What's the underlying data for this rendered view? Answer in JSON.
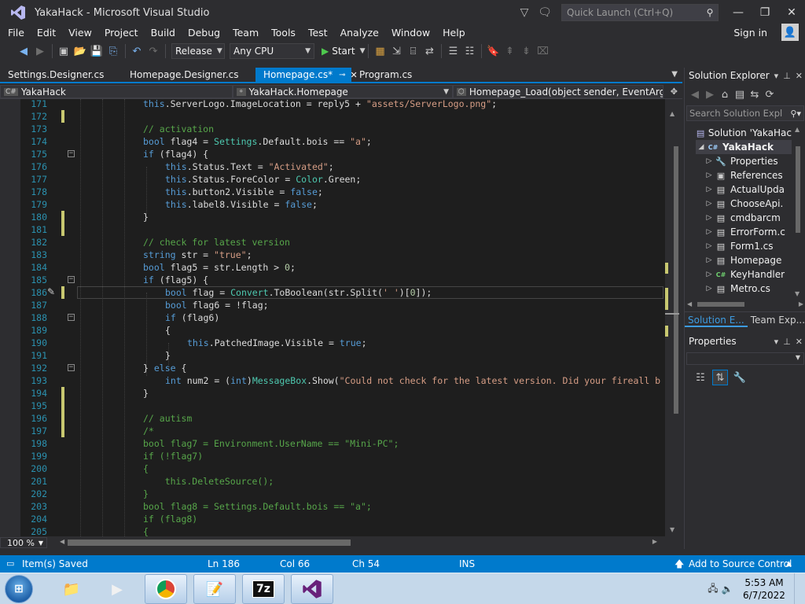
{
  "window": {
    "title": "YakaHack - Microsoft Visual Studio"
  },
  "quick_launch": {
    "placeholder": "Quick Launch (Ctrl+Q)"
  },
  "menu": [
    "File",
    "Edit",
    "View",
    "Project",
    "Build",
    "Debug",
    "Team",
    "Tools",
    "Test",
    "Analyze",
    "Window",
    "Help"
  ],
  "account": {
    "signin": "Sign in"
  },
  "toolbar": {
    "configuration": "Release",
    "platform": "Any CPU",
    "start": "Start"
  },
  "tabs": [
    {
      "label": "Settings.Designer.cs",
      "active": false
    },
    {
      "label": "Homepage.Designer.cs",
      "active": false
    },
    {
      "label": "Homepage.cs*",
      "active": true
    },
    {
      "label": "Program.cs",
      "active": false
    }
  ],
  "navbar": {
    "project": "YakaHack",
    "class": "YakaHack.Homepage",
    "member": "Homepage_Load(object sender, EventArgs e)"
  },
  "code_lines": [
    {
      "n": "171",
      "html": "<span class=\"kw\">this</span>.ServerLogo.ImageLocation = reply5 + <span class=\"str\">\"assets/ServerLogo.png\"</span>;",
      "indent": 4,
      "chg": false,
      "fold": false
    },
    {
      "n": "172",
      "html": "",
      "indent": 4,
      "chg": true,
      "fold": false
    },
    {
      "n": "173",
      "html": "<span class=\"cm\">// activation</span>",
      "indent": 4,
      "chg": false,
      "fold": false
    },
    {
      "n": "174",
      "html": "<span class=\"kw\">bool</span> flag4 = <span class=\"ty\">Settings</span>.Default.bois == <span class=\"str\">\"a\"</span>;",
      "indent": 4,
      "chg": false,
      "fold": false
    },
    {
      "n": "175",
      "html": "<span class=\"kw\">if</span> (flag4) {",
      "indent": 4,
      "chg": false,
      "fold": true
    },
    {
      "n": "176",
      "html": "<span class=\"kw\">this</span>.Status.Text = <span class=\"str\">\"Activated\"</span>;",
      "indent": 8,
      "chg": false,
      "fold": false
    },
    {
      "n": "177",
      "html": "<span class=\"kw\">this</span>.Status.ForeColor = <span class=\"ty\">Color</span>.Green;",
      "indent": 8,
      "chg": false,
      "fold": false
    },
    {
      "n": "178",
      "html": "<span class=\"kw\">this</span>.button2.Visible = <span class=\"kw\">false</span>;",
      "indent": 8,
      "chg": false,
      "fold": false
    },
    {
      "n": "179",
      "html": "<span class=\"kw\">this</span>.label8.Visible = <span class=\"kw\">false</span>;",
      "indent": 8,
      "chg": false,
      "fold": false
    },
    {
      "n": "180",
      "html": "}",
      "indent": 4,
      "chg": true,
      "fold": false
    },
    {
      "n": "181",
      "html": "",
      "indent": 4,
      "chg": true,
      "fold": false
    },
    {
      "n": "182",
      "html": "<span class=\"cm\">// check for latest version</span>",
      "indent": 4,
      "chg": false,
      "fold": false
    },
    {
      "n": "183",
      "html": "<span class=\"kw\">string</span> str = <span class=\"str\">\"true\"</span>;",
      "indent": 4,
      "chg": false,
      "fold": false
    },
    {
      "n": "184",
      "html": "<span class=\"kw\">bool</span> flag5 = str.Length &gt; <span class=\"num\">0</span>;",
      "indent": 4,
      "chg": false,
      "fold": false
    },
    {
      "n": "185",
      "html": "<span class=\"kw\">if</span> (flag5) {",
      "indent": 4,
      "chg": false,
      "fold": true
    },
    {
      "n": "186",
      "html": "<span class=\"kw\">bool</span> flag = <span class=\"ty\">Convert</span>.ToBoolean(str.Split(<span class=\"str\">' '</span>)[<span class=\"num\">0</span>]);",
      "indent": 8,
      "chg": true,
      "fold": false
    },
    {
      "n": "187",
      "html": "<span class=\"kw\">bool</span> flag6 = !flag;",
      "indent": 8,
      "chg": false,
      "fold": false
    },
    {
      "n": "188",
      "html": "<span class=\"kw\">if</span> (flag6)",
      "indent": 8,
      "chg": false,
      "fold": true
    },
    {
      "n": "189",
      "html": "{",
      "indent": 8,
      "chg": false,
      "fold": false
    },
    {
      "n": "190",
      "html": "<span class=\"kw\">this</span>.PatchedImage.Visible = <span class=\"kw\">true</span>;",
      "indent": 12,
      "chg": false,
      "fold": false
    },
    {
      "n": "191",
      "html": "}",
      "indent": 8,
      "chg": false,
      "fold": false
    },
    {
      "n": "192",
      "html": "} <span class=\"kw\">else</span> {",
      "indent": 4,
      "chg": false,
      "fold": true
    },
    {
      "n": "193",
      "html": "<span class=\"kw\">int</span> num2 = (<span class=\"kw\">int</span>)<span class=\"ty\">MessageBox</span>.Show(<span class=\"str\">\"Could not check for the latest version. Did your fireall b</span>",
      "indent": 8,
      "chg": false,
      "fold": false
    },
    {
      "n": "194",
      "html": "}",
      "indent": 4,
      "chg": true,
      "fold": false
    },
    {
      "n": "195",
      "html": "",
      "indent": 4,
      "chg": true,
      "fold": false
    },
    {
      "n": "196",
      "html": "<span class=\"cm\">// autism</span>",
      "indent": 4,
      "chg": true,
      "fold": false
    },
    {
      "n": "197",
      "html": "<span class=\"cm\">/*</span>",
      "indent": 4,
      "chg": true,
      "fold": false
    },
    {
      "n": "198",
      "html": "<span class=\"cm\">bool flag7 = Environment.UserName == \"Mini-PC\";</span>",
      "indent": 4,
      "chg": false,
      "fold": false
    },
    {
      "n": "199",
      "html": "<span class=\"cm\">if (!flag7)</span>",
      "indent": 4,
      "chg": false,
      "fold": false
    },
    {
      "n": "200",
      "html": "<span class=\"cm\">{</span>",
      "indent": 4,
      "chg": false,
      "fold": false
    },
    {
      "n": "201",
      "html": "<span class=\"cm\">    this.DeleteSource();</span>",
      "indent": 4,
      "chg": false,
      "fold": false
    },
    {
      "n": "202",
      "html": "<span class=\"cm\">}</span>",
      "indent": 4,
      "chg": false,
      "fold": false
    },
    {
      "n": "203",
      "html": "<span class=\"cm\">bool flag8 = Settings.Default.bois == \"a\";</span>",
      "indent": 4,
      "chg": false,
      "fold": false
    },
    {
      "n": "204",
      "html": "<span class=\"cm\">if (flag8)</span>",
      "indent": 4,
      "chg": false,
      "fold": false
    },
    {
      "n": "205",
      "html": "<span class=\"cm\">{</span>",
      "indent": 4,
      "chg": false,
      "fold": false
    }
  ],
  "editor": {
    "zoom": "100 %"
  },
  "solution_explorer": {
    "title": "Solution Explorer",
    "search_placeholder": "Search Solution Expl",
    "items": [
      {
        "label": "Solution 'YakaHac",
        "icon": "solution-icon",
        "depth": 0,
        "arrow": "",
        "sel": false
      },
      {
        "label": "YakaHack",
        "icon": "csharp-project-icon",
        "depth": 1,
        "arrow": "◢",
        "sel": true
      },
      {
        "label": "Properties",
        "icon": "wrench-icon",
        "depth": 2,
        "arrow": "▷",
        "sel": false
      },
      {
        "label": "References",
        "icon": "references-icon",
        "depth": 2,
        "arrow": "▷",
        "sel": false
      },
      {
        "label": "ActualUpda",
        "icon": "form-icon",
        "depth": 2,
        "arrow": "▷",
        "sel": false
      },
      {
        "label": "ChooseApi.",
        "icon": "form-icon",
        "depth": 2,
        "arrow": "▷",
        "sel": false
      },
      {
        "label": "cmdbarcm",
        "icon": "form-icon",
        "depth": 2,
        "arrow": "▷",
        "sel": false
      },
      {
        "label": "ErrorForm.c",
        "icon": "form-icon",
        "depth": 2,
        "arrow": "▷",
        "sel": false
      },
      {
        "label": "Form1.cs",
        "icon": "form-icon",
        "depth": 2,
        "arrow": "▷",
        "sel": false
      },
      {
        "label": "Homepage",
        "icon": "form-icon",
        "depth": 2,
        "arrow": "▷",
        "sel": false
      },
      {
        "label": "KeyHandler",
        "icon": "csharp-file-icon",
        "depth": 2,
        "arrow": "▷",
        "sel": false
      },
      {
        "label": "Metro.cs",
        "icon": "form-icon",
        "depth": 2,
        "arrow": "▷",
        "sel": false
      }
    ],
    "tabs": [
      "Solution E...",
      "Team Exp..."
    ]
  },
  "properties": {
    "title": "Properties"
  },
  "status": {
    "message": "Item(s) Saved",
    "line": "Ln 186",
    "col": "Col 66",
    "ch": "Ch 54",
    "mode": "INS",
    "source_control": "Add to Source Control"
  },
  "taskbar": {
    "time": "5:53 AM",
    "date": "6/7/2022"
  },
  "colors": {
    "accent": "#007acc",
    "background": "#1e1e1e"
  }
}
